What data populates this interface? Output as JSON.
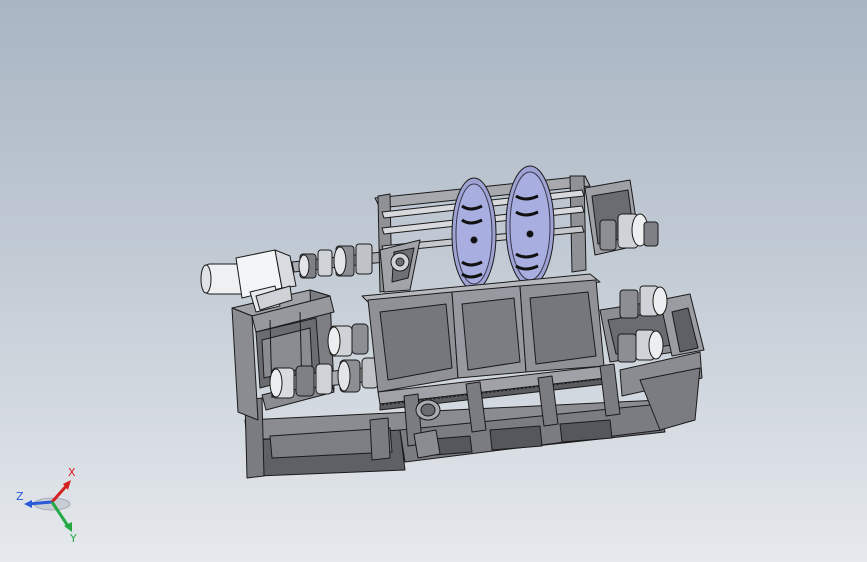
{
  "viewport": {
    "background_top": "#a9b5c3",
    "background_bottom": "#e6e9ed"
  },
  "model": {
    "part_colors": {
      "frame": "#8a8c92",
      "frame_dark": "#5e6066",
      "hopper": "#9a9ca2",
      "motor": "#eef0f2",
      "disc": "#9fa3d4",
      "edge": "#1a1a1a"
    }
  },
  "triad": {
    "x_label": "X",
    "y_label": "Y",
    "z_label": "Z",
    "x_color": "#d42020",
    "y_color": "#22a844",
    "z_color": "#2a5ad8"
  }
}
